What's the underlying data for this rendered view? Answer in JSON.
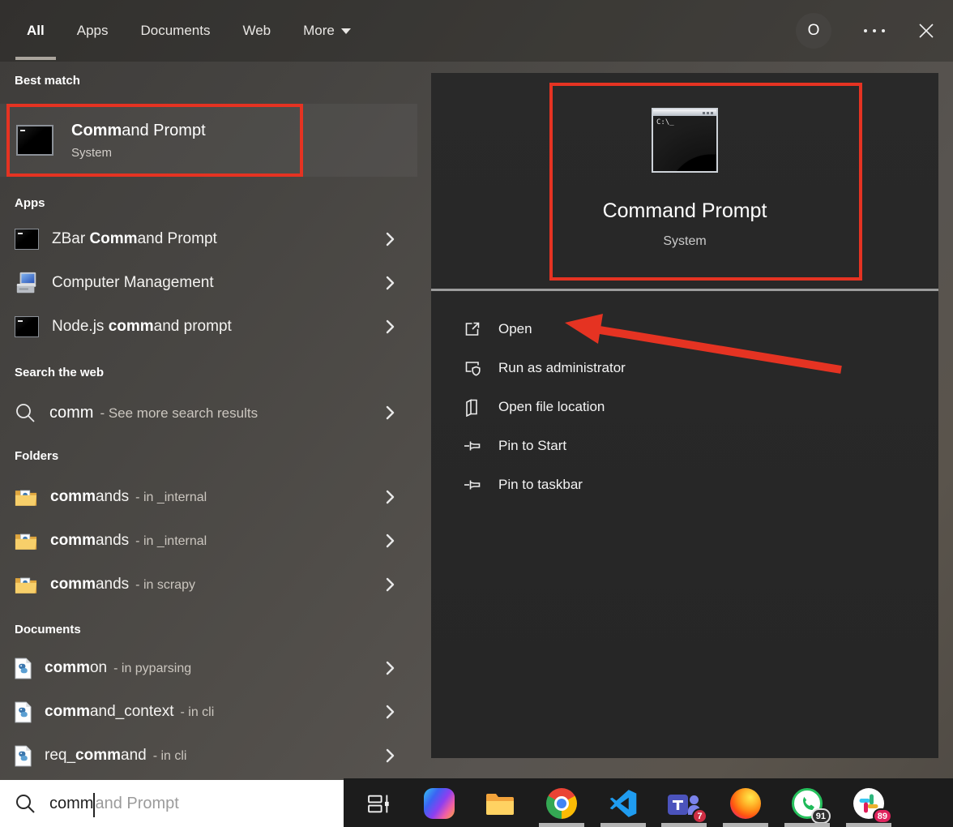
{
  "topbar": {
    "tabs": [
      {
        "label": "All",
        "active": true
      },
      {
        "label": "Apps"
      },
      {
        "label": "Documents"
      },
      {
        "label": "Web"
      },
      {
        "label": "More"
      }
    ],
    "avatar_letter": "O"
  },
  "left": {
    "best_header": "Best match",
    "best_item": {
      "match": "Comm",
      "post": "and Prompt",
      "subtitle": "System"
    },
    "apps_header": "Apps",
    "apps_items": [
      {
        "pre": "ZBar ",
        "match": "Comm",
        "post": "and Prompt"
      },
      {
        "pre": "Computer Management",
        "match": "",
        "post": ""
      },
      {
        "pre": "Node.js ",
        "match": "comm",
        "post": "and prompt"
      }
    ],
    "web_header": "Search the web",
    "web_item": {
      "main": "comm",
      "secondary": "- See more search results"
    },
    "folders_header": "Folders",
    "folders_items": [
      {
        "match": "comm",
        "post": "ands",
        "secondary": "- in _internal"
      },
      {
        "match": "comm",
        "post": "ands",
        "secondary": "- in _internal"
      },
      {
        "match": "comm",
        "post": "ands",
        "secondary": "- in scrapy"
      }
    ],
    "documents_header": "Documents",
    "documents_items": [
      {
        "pre": "",
        "match": "comm",
        "post": "on",
        "secondary": "- in pyparsing"
      },
      {
        "pre": "",
        "match": "comm",
        "post": "and_context",
        "secondary": "- in cli"
      },
      {
        "pre": "req_",
        "match": "comm",
        "post": "and",
        "secondary": "- in cli"
      }
    ]
  },
  "preview": {
    "title": "Command Prompt",
    "subtitle": "System",
    "icon_text": "C:\\_",
    "actions": [
      "Open",
      "Run as administrator",
      "Open file location",
      "Pin to Start",
      "Pin to taskbar"
    ]
  },
  "search": {
    "typed": "comm",
    "suggestion": "and Prompt"
  },
  "taskbar": {
    "badges": {
      "teams": "7",
      "whatsapp": "91",
      "slack": "89"
    }
  },
  "colors": {
    "annotation": "#e53322",
    "divider": "#9d9d9d"
  }
}
